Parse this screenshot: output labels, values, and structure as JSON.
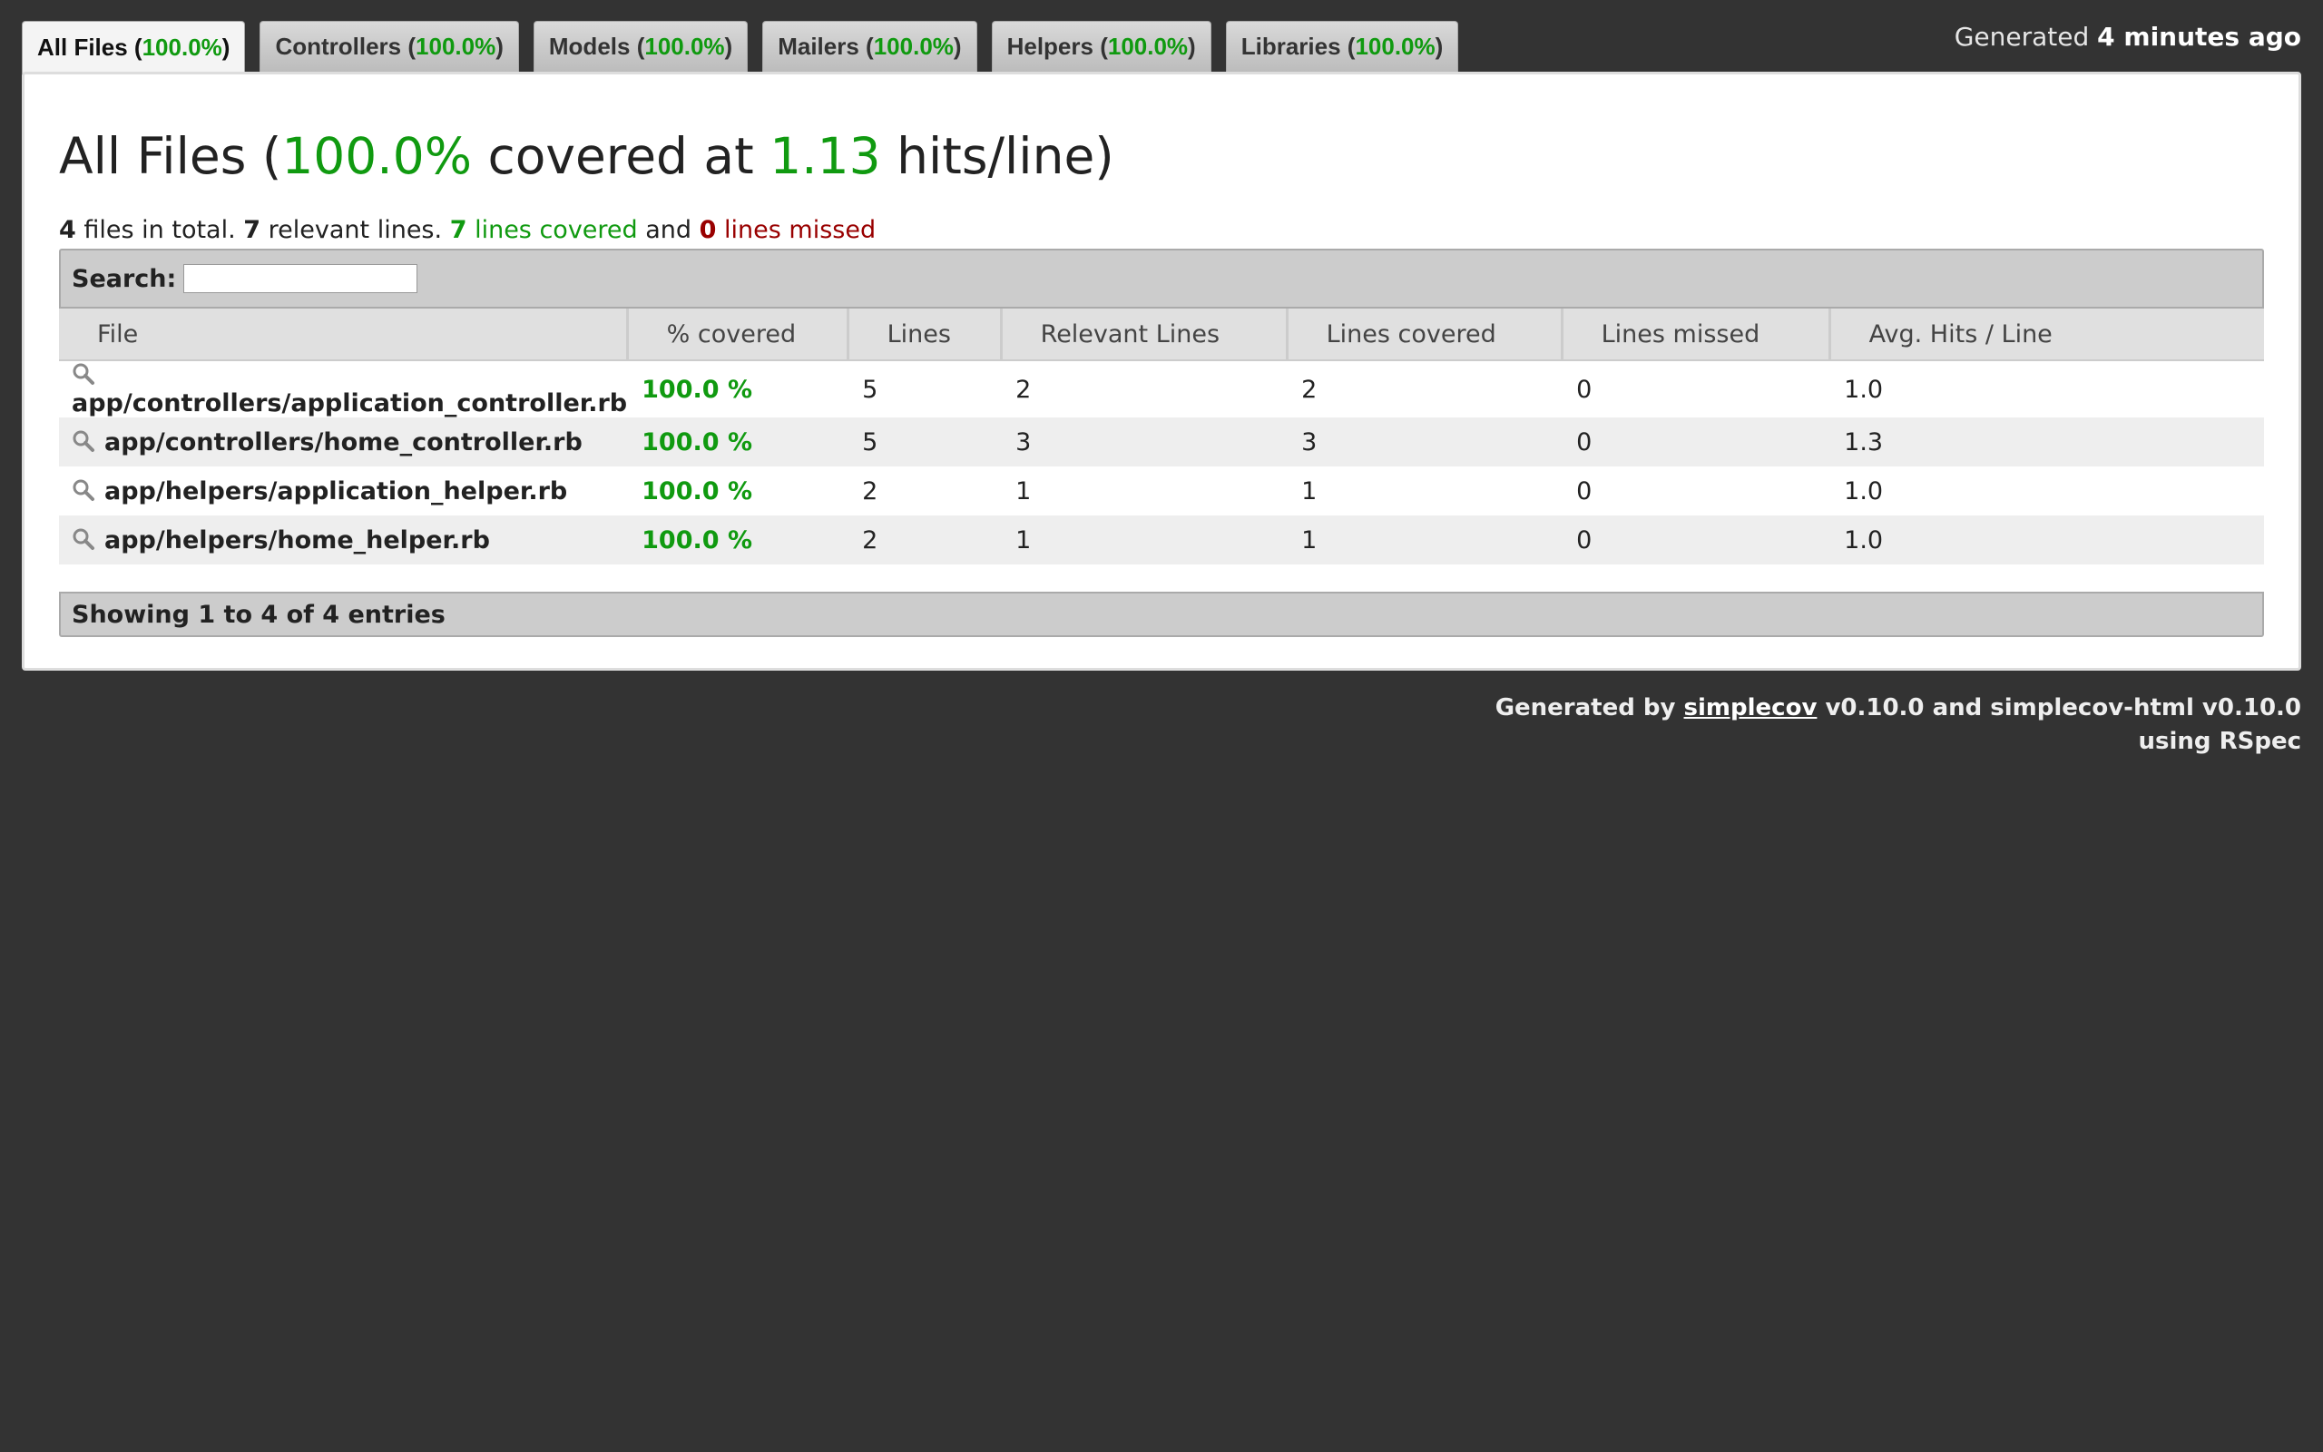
{
  "tabs": [
    {
      "name": "All Files",
      "pct": "100.0%"
    },
    {
      "name": "Controllers",
      "pct": "100.0%"
    },
    {
      "name": "Models",
      "pct": "100.0%"
    },
    {
      "name": "Mailers",
      "pct": "100.0%"
    },
    {
      "name": "Helpers",
      "pct": "100.0%"
    },
    {
      "name": "Libraries",
      "pct": "100.0%"
    }
  ],
  "generated": {
    "prefix": "Generated",
    "time": "4 minutes ago"
  },
  "heading": {
    "title": "All Files",
    "pct": "100.0%",
    "covered_at": "covered at",
    "hits": "1.13",
    "unit": "hits/line)"
  },
  "summary": {
    "files": "4",
    "files_text": "files in total.",
    "relevant": "7",
    "relevant_text": "relevant lines.",
    "covered": "7",
    "covered_text": "lines covered",
    "and": "and",
    "missed": "0",
    "missed_text": "lines missed"
  },
  "search": {
    "label": "Search:",
    "value": ""
  },
  "table": {
    "headers": [
      "File",
      "% covered",
      "Lines",
      "Relevant Lines",
      "Lines covered",
      "Lines missed",
      "Avg. Hits / Line"
    ],
    "rows": [
      [
        "app/controllers/application_controller.rb",
        "100.0 %",
        "5",
        "2",
        "2",
        "0",
        "1.0"
      ],
      [
        "app/controllers/home_controller.rb",
        "100.0 %",
        "5",
        "3",
        "3",
        "0",
        "1.3"
      ],
      [
        "app/helpers/application_helper.rb",
        "100.0 %",
        "2",
        "1",
        "1",
        "0",
        "1.0"
      ],
      [
        "app/helpers/home_helper.rb",
        "100.0 %",
        "2",
        "1",
        "1",
        "0",
        "1.0"
      ]
    ]
  },
  "info": "Showing 1 to 4 of 4 entries",
  "credit": {
    "by": "Generated by",
    "link": "simplecov",
    "rest": "v0.10.0 and simplecov-html v0.10.0",
    "line2": "using RSpec"
  },
  "colors": {
    "covered": "#109a10",
    "missed": "#990000",
    "background": "#333333"
  }
}
